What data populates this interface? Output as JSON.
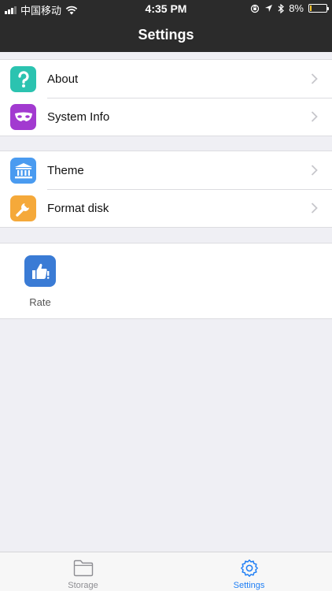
{
  "status_bar": {
    "carrier": "中国移动",
    "time": "4:35 PM",
    "battery_percent_label": "8%",
    "battery_level": 0.08
  },
  "nav": {
    "title": "Settings"
  },
  "groups": [
    {
      "items": [
        {
          "label": "About",
          "icon": "question-icon",
          "color": "#2bc3b0"
        },
        {
          "label": "System Info",
          "icon": "mask-icon",
          "color": "#a23ad0"
        }
      ]
    },
    {
      "items": [
        {
          "label": "Theme",
          "icon": "bank-icon",
          "color": "#4a9bf0"
        },
        {
          "label": "Format disk",
          "icon": "wrench-icon",
          "color": "#f5a93a"
        }
      ]
    }
  ],
  "rate": {
    "label": "Rate",
    "icon": "thumbs-up-icon",
    "color": "#3a7bd5"
  },
  "tabs": [
    {
      "label": "Storage",
      "icon": "folder-icon",
      "active": false
    },
    {
      "label": "Settings",
      "icon": "gear-icon",
      "active": true
    }
  ],
  "colors": {
    "bar_background": "#2b2b2b",
    "active_tab": "#1f7ff5",
    "inactive_tab": "#8e8e93"
  }
}
